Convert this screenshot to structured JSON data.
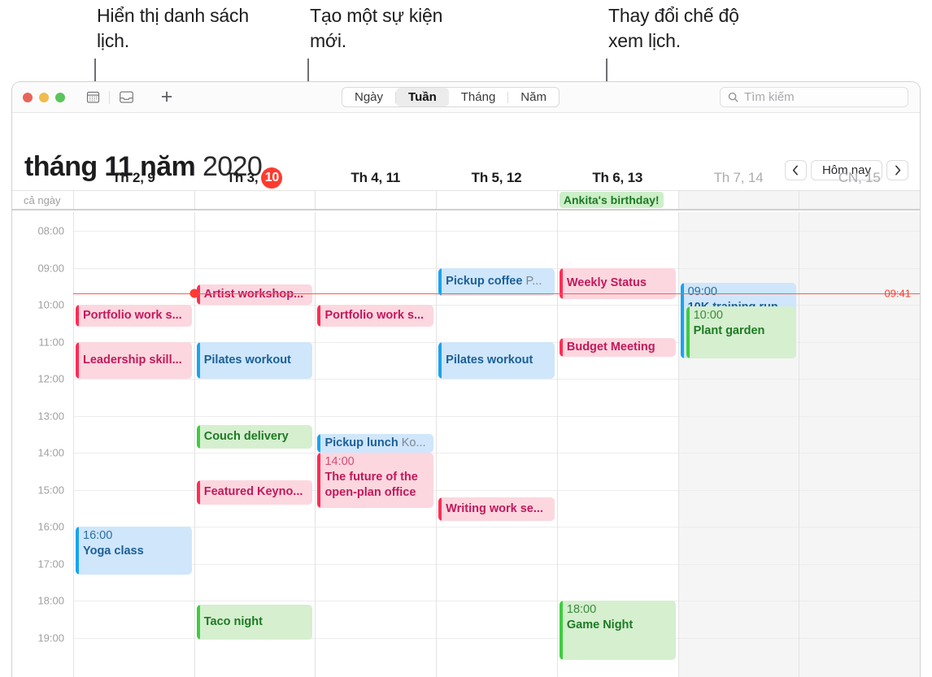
{
  "callouts": [
    {
      "id": "show-calendar-list",
      "text": "Hiển thị danh sách lịch."
    },
    {
      "id": "create-new-event",
      "text": "Tạo một sự kiện mới."
    },
    {
      "id": "change-calendar-view",
      "text": "Thay đổi chế độ xem lịch."
    }
  ],
  "toolbar": {
    "calendar_list_icon": "calendar-icon",
    "inbox_icon": "inbox-icon",
    "add_label": "+",
    "view_modes": [
      {
        "label": "Ngày",
        "active": false
      },
      {
        "label": "Tuần",
        "active": true
      },
      {
        "label": "Tháng",
        "active": false
      },
      {
        "label": "Năm",
        "active": false
      }
    ],
    "search": {
      "placeholder": "Tìm kiếm",
      "value": ""
    }
  },
  "header": {
    "title_bold": "tháng 11 năm",
    "title_year": "2020",
    "prev_label": "‹",
    "today_label": "Hôm nay",
    "next_label": "›"
  },
  "grid": {
    "allday_label": "cả ngày",
    "days": [
      {
        "label": "Th 2, 9",
        "weekend": false,
        "today": false
      },
      {
        "label": "Th 3,",
        "weekend": false,
        "today": true,
        "today_number": "10"
      },
      {
        "label": "Th 4, 11",
        "weekend": false,
        "today": false
      },
      {
        "label": "Th 5, 12",
        "weekend": false,
        "today": false
      },
      {
        "label": "Th 6, 13",
        "weekend": false,
        "today": false
      },
      {
        "label": "Th 7, 14",
        "weekend": true,
        "today": false
      },
      {
        "label": "CN, 15",
        "weekend": true,
        "today": false
      }
    ],
    "hours": [
      "08:00",
      "09:00",
      "10:00",
      "11:00",
      "12:00",
      "13:00",
      "14:00",
      "15:00",
      "16:00",
      "17:00",
      "18:00",
      "19:00"
    ],
    "now": {
      "label": "09:41",
      "day_index": 1
    },
    "allday_events": [
      {
        "day": 4,
        "title": "Ankita's birthday!",
        "color": "green"
      }
    ],
    "events": [
      {
        "day": 0,
        "title": "Portfolio work s...",
        "time": "",
        "color": "red",
        "start": 10.0,
        "end": 10.6,
        "compact": true
      },
      {
        "day": 0,
        "title": "Leadership skill...",
        "time": "",
        "color": "red",
        "start": 11.0,
        "end": 12.0,
        "compact": true
      },
      {
        "day": 0,
        "title": "Yoga class",
        "time": "16:00",
        "color": "blue",
        "start": 16.0,
        "end": 17.3,
        "compact": false
      },
      {
        "day": 1,
        "title": "Artist workshop...",
        "time": "",
        "color": "red",
        "start": 9.45,
        "end": 10.0,
        "compact": true
      },
      {
        "day": 1,
        "title": "Pilates workout",
        "time": "",
        "color": "blue",
        "start": 11.0,
        "end": 12.0,
        "compact": true
      },
      {
        "day": 1,
        "title": "Couch delivery",
        "time": "",
        "color": "green",
        "start": 13.25,
        "end": 13.9,
        "compact": true
      },
      {
        "day": 1,
        "title": "Featured Keyno...",
        "time": "",
        "color": "red",
        "start": 14.75,
        "end": 15.4,
        "compact": true
      },
      {
        "day": 1,
        "title": "Taco night",
        "time": "",
        "color": "green",
        "start": 18.1,
        "end": 19.05,
        "compact": true
      },
      {
        "day": 2,
        "title": "Portfolio work s...",
        "time": "",
        "color": "red",
        "start": 10.0,
        "end": 10.6,
        "compact": true
      },
      {
        "day": 2,
        "title": "Pickup lunch",
        "location": "Ko...",
        "time": "",
        "color": "blue",
        "start": 13.5,
        "end": 14.0,
        "compact": true
      },
      {
        "day": 2,
        "title": "The future of the open-plan office",
        "time": "14:00",
        "color": "red",
        "start": 14.0,
        "end": 15.5,
        "compact": false,
        "wrap": true
      },
      {
        "day": 3,
        "title": "Pickup coffee",
        "location": "P...",
        "time": "",
        "color": "blue",
        "start": 9.0,
        "end": 9.75,
        "compact": true
      },
      {
        "day": 3,
        "title": "Pilates workout",
        "time": "",
        "color": "blue",
        "start": 11.0,
        "end": 12.0,
        "compact": true
      },
      {
        "day": 3,
        "title": "Writing work se...",
        "time": "",
        "color": "red",
        "start": 15.2,
        "end": 15.85,
        "compact": true
      },
      {
        "day": 4,
        "title": "Weekly Status",
        "time": "",
        "color": "red",
        "start": 9.0,
        "end": 9.85,
        "compact": true
      },
      {
        "day": 4,
        "title": "Budget Meeting",
        "time": "",
        "color": "red",
        "start": 10.9,
        "end": 11.4,
        "compact": true
      },
      {
        "day": 4,
        "title": "Game Night",
        "time": "18:00",
        "color": "green",
        "start": 18.0,
        "end": 19.6,
        "compact": false
      },
      {
        "day": 5,
        "title": "10K training run",
        "time": "09:00",
        "color": "blue",
        "start": 9.4,
        "end": 11.45,
        "compact": false
      },
      {
        "day": 5,
        "title": "Plant garden",
        "time": "10:00",
        "color": "green",
        "start": 10.05,
        "end": 11.45,
        "compact": false,
        "offset": 9
      }
    ]
  },
  "colors": {
    "accent_red": "#ff3b30",
    "event_red": "#ff2d55",
    "event_blue": "#1aa3ef",
    "event_green": "#3ecd3e",
    "now_line": "#ff5b52"
  }
}
